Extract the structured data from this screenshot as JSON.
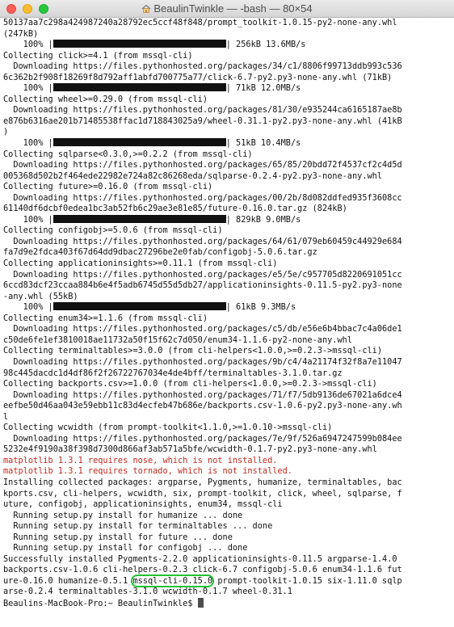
{
  "window": {
    "title": "BeaulinTwinkle — -bash — 80×54",
    "icon": "home-folder-icon"
  },
  "colors": {
    "error_text": "#c0291d",
    "highlight_ring": "#22c22e",
    "close": "#fc5f57",
    "minimize": "#fdbc2e",
    "maximize": "#28c840"
  },
  "terminal": {
    "lines": [
      {
        "type": "text",
        "text": "50137aa7c298a424987240a28792ec5ccf48f848/prompt_toolkit-1.0.15-py2-none-any.whl"
      },
      {
        "type": "text",
        "text": "(247kB)"
      },
      {
        "type": "progress",
        "prefix": "    100% |",
        "suffix": "| 256kB 13.6MB/s"
      },
      {
        "type": "text",
        "text": "Collecting click>=4.1 (from mssql-cli)"
      },
      {
        "type": "text",
        "text": "  Downloading https://files.pythonhosted.org/packages/34/c1/8806f99713ddb993c536"
      },
      {
        "type": "text",
        "text": "6c362b2f908f18269f8d792aff1abfd700775a77/click-6.7-py2.py3-none-any.whl (71kB)"
      },
      {
        "type": "progress",
        "prefix": "    100% |",
        "suffix": "| 71kB 12.0MB/s"
      },
      {
        "type": "text",
        "text": "Collecting wheel>=0.29.0 (from mssql-cli)"
      },
      {
        "type": "text",
        "text": "  Downloading https://files.pythonhosted.org/packages/81/30/e935244ca6165187ae8b"
      },
      {
        "type": "text",
        "text": "e876b6316ae201b71485538ffac1d718843025a9/wheel-0.31.1-py2.py3-none-any.whl (41kB"
      },
      {
        "type": "text",
        "text": ")"
      },
      {
        "type": "progress",
        "prefix": "    100% |",
        "suffix": "| 51kB 10.4MB/s"
      },
      {
        "type": "text",
        "text": "Collecting sqlparse<0.3.0,>=0.2.2 (from mssql-cli)"
      },
      {
        "type": "text",
        "text": "  Downloading https://files.pythonhosted.org/packages/65/85/20bdd72f4537cf2c4d5d"
      },
      {
        "type": "text",
        "text": "005368d502b2f464ede22982e724a82c86268eda/sqlparse-0.2.4-py2.py3-none-any.whl"
      },
      {
        "type": "text",
        "text": "Collecting future>=0.16.0 (from mssql-cli)"
      },
      {
        "type": "text",
        "text": "  Downloading https://files.pythonhosted.org/packages/00/2b/8d082ddfed935f3608cc"
      },
      {
        "type": "text",
        "text": "61140df6dcbf0edea1bc3ab52fb6c29ae3e81e85/future-0.16.0.tar.gz (824kB)"
      },
      {
        "type": "progress",
        "prefix": "    100% |",
        "suffix": "| 829kB 9.0MB/s"
      },
      {
        "type": "text",
        "text": "Collecting configobj>=5.0.6 (from mssql-cli)"
      },
      {
        "type": "text",
        "text": "  Downloading https://files.pythonhosted.org/packages/64/61/079eb60459c44929e684"
      },
      {
        "type": "text",
        "text": "fa7d9e2fdca403f67d64dd9dbac27296be2e0fab/configobj-5.0.6.tar.gz"
      },
      {
        "type": "text",
        "text": "Collecting applicationinsights>=0.11.1 (from mssql-cli)"
      },
      {
        "type": "text",
        "text": "  Downloading https://files.pythonhosted.org/packages/e5/5e/c957705d8220691051cc"
      },
      {
        "type": "text",
        "text": "6ccd83dcf23ccaa884b6e4f5adb6745d55d5db27/applicationinsights-0.11.5-py2.py3-none"
      },
      {
        "type": "text",
        "text": "-any.whl (55kB)"
      },
      {
        "type": "progress",
        "prefix": "    100% |",
        "suffix": "| 61kB 9.3MB/s"
      },
      {
        "type": "text",
        "text": "Collecting enum34>=1.1.6 (from mssql-cli)"
      },
      {
        "type": "text",
        "text": "  Downloading https://files.pythonhosted.org/packages/c5/db/e56e6b4bbac7c4a06de1"
      },
      {
        "type": "text",
        "text": "c50de6fe1ef3810018ae11732a50f15f62c7d050/enum34-1.1.6-py2-none-any.whl"
      },
      {
        "type": "text",
        "text": "Collecting terminaltables>=3.0.0 (from cli-helpers<1.0.0,>=0.2.3->mssql-cli)"
      },
      {
        "type": "text",
        "text": "  Downloading https://files.pythonhosted.org/packages/9b/c4/4a21174f32f8a7e11047"
      },
      {
        "type": "text",
        "text": "98c445dacdc1d4df86f2f26722767034e4de4bff/terminaltables-3.1.0.tar.gz"
      },
      {
        "type": "text",
        "text": "Collecting backports.csv>=1.0.0 (from cli-helpers<1.0.0,>=0.2.3->mssql-cli)"
      },
      {
        "type": "text",
        "text": "  Downloading https://files.pythonhosted.org/packages/71/f7/5db9136de67021a6dce4"
      },
      {
        "type": "text",
        "text": "eefbe50d46aa043e59ebb11c83d4ecfeb47b686e/backports.csv-1.0.6-py2.py3-none-any.wh"
      },
      {
        "type": "text",
        "text": "l"
      },
      {
        "type": "text",
        "text": "Collecting wcwidth (from prompt-toolkit<1.1.0,>=1.0.10->mssql-cli)"
      },
      {
        "type": "text",
        "text": "  Downloading https://files.pythonhosted.org/packages/7e/9f/526a6947247599b084ee"
      },
      {
        "type": "text",
        "text": "5232e4f9190a38f398d7300d866af3ab571a5bfe/wcwidth-0.1.7-py2.py3-none-any.whl"
      },
      {
        "type": "error",
        "text": "matplotlib 1.3.1 requires nose, which is not installed."
      },
      {
        "type": "error",
        "text": "matplotlib 1.3.1 requires tornado, which is not installed."
      },
      {
        "type": "text",
        "text": "Installing collected packages: argparse, Pygments, humanize, terminaltables, bac"
      },
      {
        "type": "text",
        "text": "kports.csv, cli-helpers, wcwidth, six, prompt-toolkit, click, wheel, sqlparse, f"
      },
      {
        "type": "text",
        "text": "uture, configobj, applicationinsights, enum34, mssql-cli"
      },
      {
        "type": "text",
        "text": "  Running setup.py install for humanize ... done"
      },
      {
        "type": "text",
        "text": "  Running setup.py install for terminaltables ... done"
      },
      {
        "type": "text",
        "text": "  Running setup.py install for future ... done"
      },
      {
        "type": "text",
        "text": "  Running setup.py install for configobj ... done"
      },
      {
        "type": "text",
        "text": "Successfully installed Pygments-2.2.0 applicationinsights-0.11.5 argparse-1.4.0"
      },
      {
        "type": "text",
        "text": "backports.csv-1.0.6 cli-helpers-0.2.3 click-6.7 configobj-5.0.6 enum34-1.1.6 fut"
      },
      {
        "type": "highlight",
        "before": "ure-0.16.0 humanize-0.5.1 ",
        "mark": "mssql-cli-0.15.0",
        "after": " prompt-toolkit-1.0.15 six-1.11.0 sqlp"
      },
      {
        "type": "text",
        "text": "arse-0.2.4 terminaltables-3.1.0 wcwidth-0.1.7 wheel-0.31.1"
      },
      {
        "type": "prompt",
        "text": "Beaulins-MacBook-Pro:~ BeaulinTwinkle$ "
      }
    ]
  }
}
